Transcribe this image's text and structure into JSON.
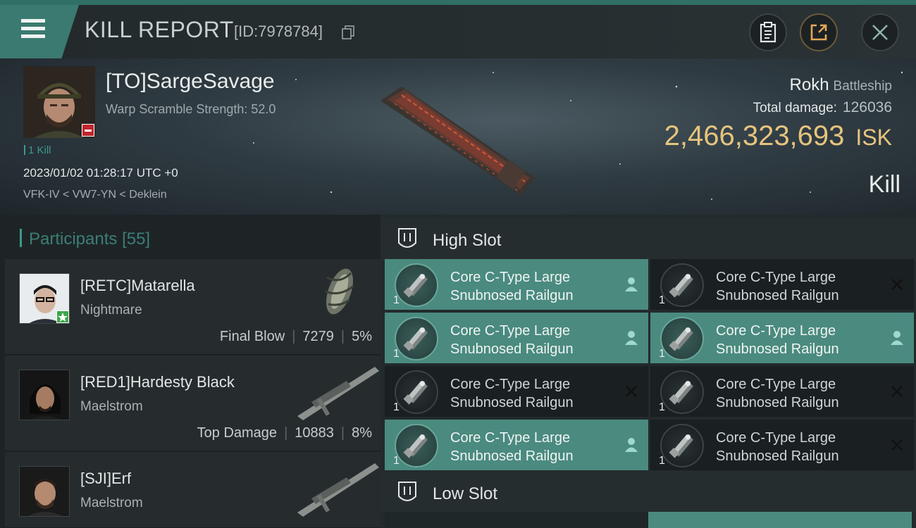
{
  "header": {
    "title": "KILL REPORT",
    "kill_id": "[ID:7978784]",
    "icons": [
      "menu-icon",
      "copy-icon",
      "clipboard-icon",
      "share-icon",
      "close-icon"
    ]
  },
  "victim": {
    "name": "[TO]SargeSavage",
    "warp_scramble": "Warp Scramble Strength: 52.0",
    "kill_count": "1 Kill",
    "datetime": "2023/01/02 01:28:17 UTC +0",
    "location": "VFK-IV < VW7-YN < Deklein",
    "ship_name": "Rokh",
    "ship_class": "Battleship",
    "total_damage_label": "Total damage:",
    "total_damage": "126036",
    "isk_value": "2,466,323,693",
    "isk_unit": "ISK",
    "result": "Kill"
  },
  "participants": {
    "label": "Participants",
    "count": "[55]",
    "rows": [
      {
        "name": "[RETC]Matarella",
        "ship": "Nightmare",
        "role": "Final Blow",
        "damage": "7279",
        "percent": "5%"
      },
      {
        "name": "[RED1]Hardesty Black",
        "ship": "Maelstrom",
        "role": "Top Damage",
        "damage": "10883",
        "percent": "8%"
      },
      {
        "name": "[SJI]Erf",
        "ship": "Maelstrom"
      }
    ]
  },
  "fitting": {
    "high_slot_label": "High Slot",
    "low_slot_label": "Low Slot",
    "high_slot_modules": [
      {
        "name_line1": "Core C-Type Large",
        "name_line2": "Snubnosed Railgun",
        "qty": "1",
        "state": "dropped"
      },
      {
        "name_line1": "Core C-Type Large",
        "name_line2": "Snubnosed Railgun",
        "qty": "1",
        "state": "destroyed"
      },
      {
        "name_line1": "Core C-Type Large",
        "name_line2": "Snubnosed Railgun",
        "qty": "1",
        "state": "dropped"
      },
      {
        "name_line1": "Core C-Type Large",
        "name_line2": "Snubnosed Railgun",
        "qty": "1",
        "state": "dropped"
      },
      {
        "name_line1": "Core C-Type Large",
        "name_line2": "Snubnosed Railgun",
        "qty": "1",
        "state": "destroyed"
      },
      {
        "name_line1": "Core C-Type Large",
        "name_line2": "Snubnosed Railgun",
        "qty": "1",
        "state": "destroyed"
      },
      {
        "name_line1": "Core C-Type Large",
        "name_line2": "Snubnosed Railgun",
        "qty": "1",
        "state": "dropped"
      },
      {
        "name_line1": "Core C-Type Large",
        "name_line2": "Snubnosed Railgun",
        "qty": "1",
        "state": "destroyed"
      }
    ]
  },
  "colors": {
    "accent_teal": "#3d9a8a",
    "active_module": "#4a8a7f",
    "isk_gold": "#e6c47e",
    "security_negative": "#c0262d"
  }
}
